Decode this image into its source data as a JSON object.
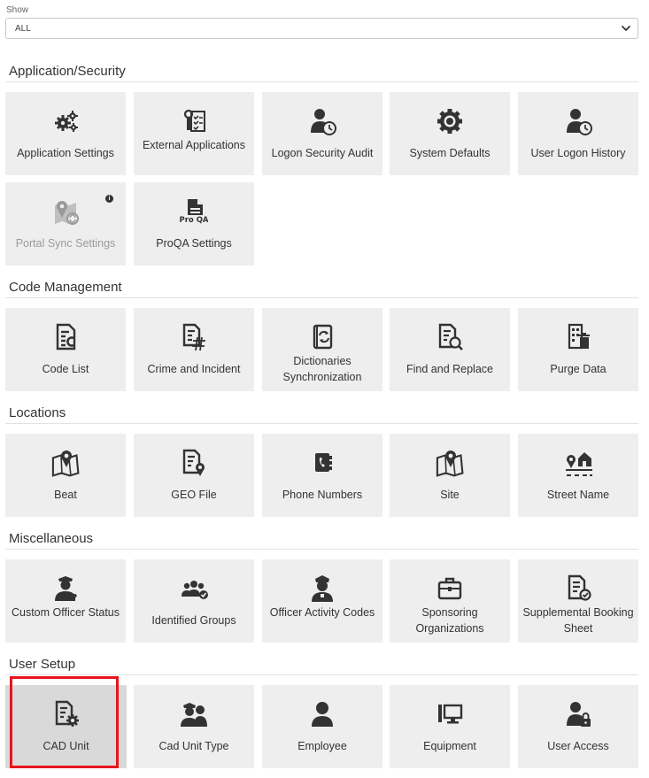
{
  "filter": {
    "label": "Show",
    "value": "ALL"
  },
  "sections": [
    {
      "title": "Application/Security",
      "tiles": [
        {
          "label": "Application Settings",
          "icon": "gears-icon"
        },
        {
          "label": "External Applications",
          "icon": "id-badge-checklist-icon"
        },
        {
          "label": "Logon Security Audit",
          "icon": "user-clock-icon"
        },
        {
          "label": "System Defaults",
          "icon": "gear-icon"
        },
        {
          "label": "User Logon History",
          "icon": "user-clock-icon"
        },
        {
          "label": "Portal Sync Settings",
          "icon": "map-sync-icon",
          "disabled": true
        },
        {
          "label": "ProQA Settings",
          "icon": "proqa-document-icon",
          "badge_text": "Pro QA"
        }
      ]
    },
    {
      "title": "Code Management",
      "tiles": [
        {
          "label": "Code List",
          "icon": "document-c-icon"
        },
        {
          "label": "Crime and Incident",
          "icon": "document-hash-icon"
        },
        {
          "label": "Dictionaries Synchronization",
          "icon": "book-sync-icon"
        },
        {
          "label": "Find and Replace",
          "icon": "document-search-icon"
        },
        {
          "label": "Purge Data",
          "icon": "building-trash-icon"
        }
      ]
    },
    {
      "title": "Locations",
      "tiles": [
        {
          "label": "Beat",
          "icon": "map-pin-icon"
        },
        {
          "label": "GEO File",
          "icon": "document-pin-icon"
        },
        {
          "label": "Phone Numbers",
          "icon": "phone-book-icon"
        },
        {
          "label": "Site",
          "icon": "map-pin-icon"
        },
        {
          "label": "Street Name",
          "icon": "house-street-icon"
        }
      ]
    },
    {
      "title": "Miscellaneous",
      "tiles": [
        {
          "label": "Custom Officer Status",
          "icon": "officer-question-icon"
        },
        {
          "label": "Identified Groups",
          "icon": "group-check-icon"
        },
        {
          "label": "Officer Activity Codes",
          "icon": "officer-icon"
        },
        {
          "label": "Sponsoring Organizations",
          "icon": "briefcase-icon"
        },
        {
          "label": "Supplemental Booking Sheet",
          "icon": "document-check-icon"
        }
      ]
    },
    {
      "title": "User Setup",
      "tiles": [
        {
          "label": "CAD Unit",
          "icon": "document-gear-icon",
          "selected": true
        },
        {
          "label": "Cad Unit Type",
          "icon": "officer-pair-icon"
        },
        {
          "label": "Employee",
          "icon": "user-icon"
        },
        {
          "label": "Equipment",
          "icon": "computer-icon"
        },
        {
          "label": "User Access",
          "icon": "user-lock-icon"
        }
      ]
    }
  ],
  "colors": {
    "tile_bg": "#eeeeee",
    "tile_selected_bg": "#d9d9d9",
    "highlight": "#e8141b",
    "icon": "#333333"
  }
}
